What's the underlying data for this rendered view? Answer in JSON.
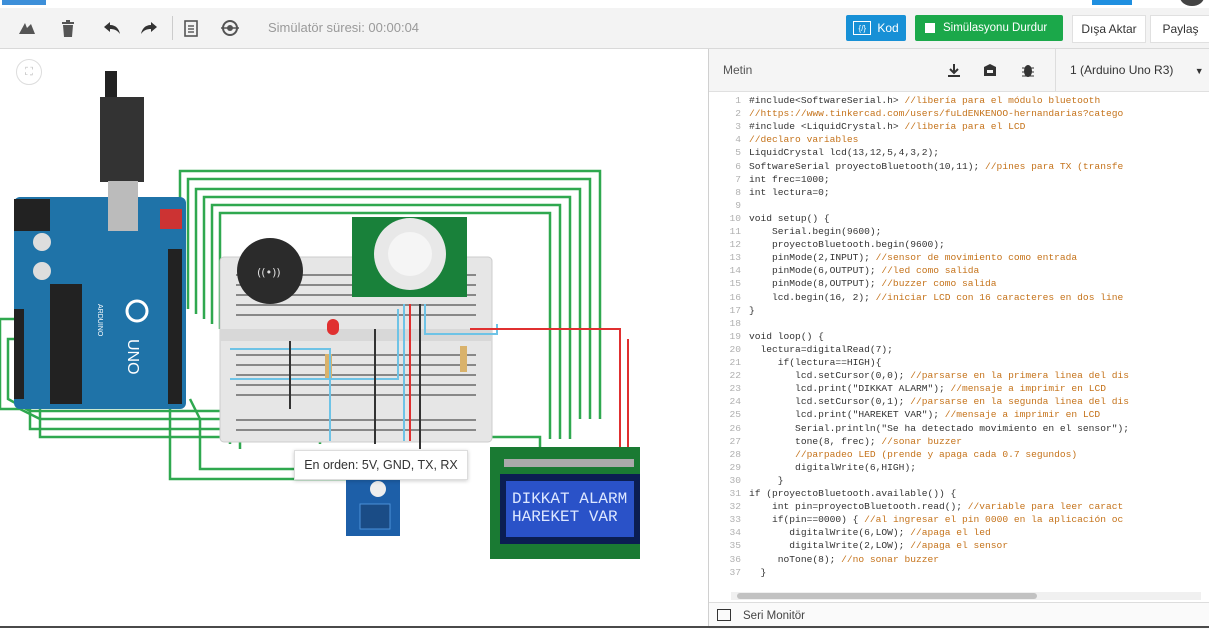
{
  "toolbar": {
    "icons": [
      "rotate-icon",
      "trash-icon",
      "undo-icon",
      "redo-icon",
      "notes-icon",
      "eye-icon"
    ],
    "timer": "Simülatör süresi: 00:00:04",
    "kod_label": "Kod",
    "sim_label": "Simülasyonu Durdur",
    "export_label": "Dışa Aktar",
    "share_label": "Paylaş",
    "kod_icon_glyph": "{/}"
  },
  "panel": {
    "title": "Metin",
    "board_select": "1 (Arduino Uno R3)",
    "serial_label": "Seri Monitör"
  },
  "circuit": {
    "tooltip": "En orden: 5V, GND, TX, RX",
    "lcd_line1": "DIKKAT ALARM",
    "lcd_line2": "HAREKET VAR",
    "buzzer_label": "((•))",
    "arduino_brand": "UNO",
    "arduino_sub": "ARDUINO"
  },
  "code_lines": [
    {
      "n": "1",
      "t": "#include<SoftwareSerial.h> ",
      "c": "//libería para el módulo bluetooth"
    },
    {
      "n": "2",
      "t": "",
      "c": "//https://www.tinkercad.com/users/fuLdENKENOO-hernandarias?catego"
    },
    {
      "n": "3",
      "t": "#include <LiquidCrystal.h> ",
      "c": "//libería para el LCD"
    },
    {
      "n": "4",
      "t": "",
      "c": "//declaro variables"
    },
    {
      "n": "5",
      "t": "LiquidCrystal lcd(13,12,5,4,3,2);",
      "c": ""
    },
    {
      "n": "6",
      "t": "SoftwareSerial proyectoBluetooth(10,11); ",
      "c": "//pines para TX (transfe"
    },
    {
      "n": "7",
      "t": "int frec=1000;",
      "c": ""
    },
    {
      "n": "8",
      "t": "int lectura=0;",
      "c": ""
    },
    {
      "n": "9",
      "t": "",
      "c": ""
    },
    {
      "n": "10",
      "t": "void setup() {",
      "c": ""
    },
    {
      "n": "11",
      "t": "    Serial.begin(9600);",
      "c": ""
    },
    {
      "n": "12",
      "t": "    proyectoBluetooth.begin(9600);",
      "c": ""
    },
    {
      "n": "13",
      "t": "    pinMode(2,INPUT); ",
      "c": "//sensor de movimiento como entrada"
    },
    {
      "n": "14",
      "t": "    pinMode(6,OUTPUT); ",
      "c": "//led como salida"
    },
    {
      "n": "15",
      "t": "    pinMode(8,OUTPUT); ",
      "c": "//buzzer como salida"
    },
    {
      "n": "16",
      "t": "    lcd.begin(16, 2); ",
      "c": "//iniciar LCD con 16 caracteres en dos line"
    },
    {
      "n": "17",
      "t": "}",
      "c": ""
    },
    {
      "n": "18",
      "t": "",
      "c": ""
    },
    {
      "n": "19",
      "t": "void loop() {",
      "c": ""
    },
    {
      "n": "20",
      "t": "  lectura=digitalRead(7);",
      "c": ""
    },
    {
      "n": "21",
      "t": "     if(lectura==HIGH){",
      "c": ""
    },
    {
      "n": "22",
      "t": "        lcd.setCursor(0,0); ",
      "c": "//parsarse en la primera linea del dis"
    },
    {
      "n": "23",
      "t": "        lcd.print(\"DIKKAT ALARM\"); ",
      "c": "//mensaje a imprimir en LCD"
    },
    {
      "n": "24",
      "t": "        lcd.setCursor(0,1); ",
      "c": "//parsarse en la segunda linea del dis"
    },
    {
      "n": "25",
      "t": "        lcd.print(\"HAREKET VAR\"); ",
      "c": "//mensaje a imprimir en LCD"
    },
    {
      "n": "26",
      "t": "        Serial.println(\"Se ha detectado movimiento en el sensor\");",
      "c": ""
    },
    {
      "n": "27",
      "t": "        tone(8, frec); ",
      "c": "//sonar buzzer"
    },
    {
      "n": "28",
      "t": "        ",
      "c": "//parpadeo LED (prende y apaga cada 0.7 segundos)"
    },
    {
      "n": "29",
      "t": "        digitalWrite(6,HIGH);",
      "c": ""
    },
    {
      "n": "30",
      "t": "     }",
      "c": ""
    },
    {
      "n": "31",
      "t": "if (proyectoBluetooth.available()) {",
      "c": ""
    },
    {
      "n": "32",
      "t": "    int pin=proyectoBluetooth.read(); ",
      "c": "//variable para leer caract"
    },
    {
      "n": "33",
      "t": "    if(pin==0000) { ",
      "c": "//al ingresar el pin 0000 en la aplicación oc"
    },
    {
      "n": "34",
      "t": "       digitalWrite(6,LOW); ",
      "c": "//apaga el led"
    },
    {
      "n": "35",
      "t": "       digitalWrite(2,LOW); ",
      "c": "//apaga el sensor"
    },
    {
      "n": "36",
      "t": "     noTone(8); ",
      "c": "//no sonar buzzer"
    },
    {
      "n": "37",
      "t": "  }",
      "c": ""
    }
  ]
}
